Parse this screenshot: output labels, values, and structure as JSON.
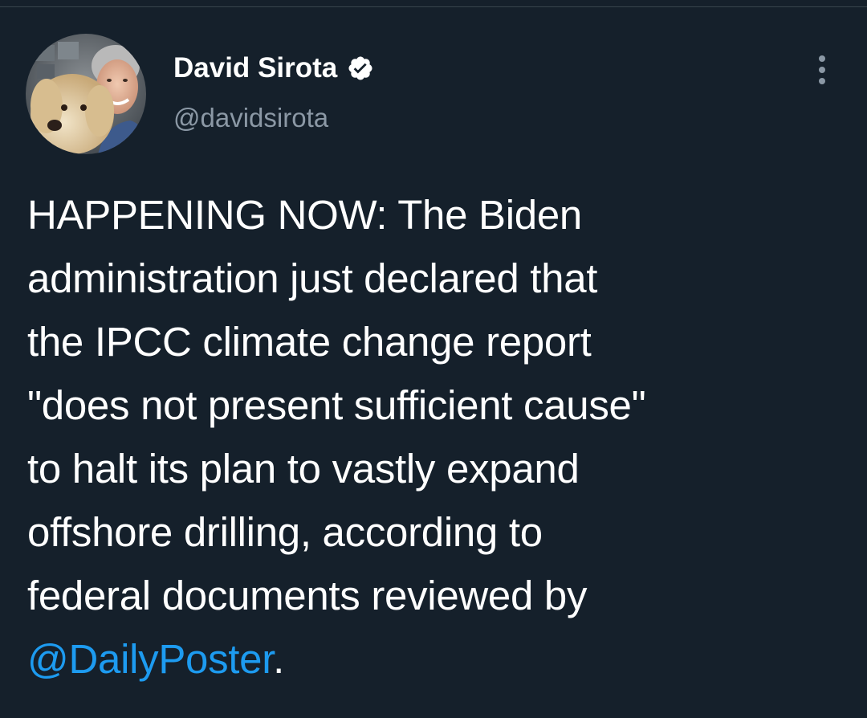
{
  "colors": {
    "background": "#15202b",
    "text": "#ffffff",
    "secondary_text": "#8b98a5",
    "link": "#1d9bf0",
    "verified_badge": "#ffffff"
  },
  "author": {
    "display_name": "David Sirota",
    "handle": "@davidsirota",
    "verified": true,
    "verified_icon": "verified-badge-icon",
    "avatar": "profile photo of man with dog"
  },
  "menu": {
    "icon": "more-options-icon"
  },
  "tweet": {
    "lines": [
      "HAPPENING NOW: The Biden",
      "administration just declared that",
      "the IPCC climate change report",
      "\"does not present sufficient cause\"",
      "to halt its plan to vastly expand",
      "offshore drilling, according to",
      "federal documents reviewed by"
    ],
    "mention": "@DailyPoster",
    "trailing": "."
  }
}
